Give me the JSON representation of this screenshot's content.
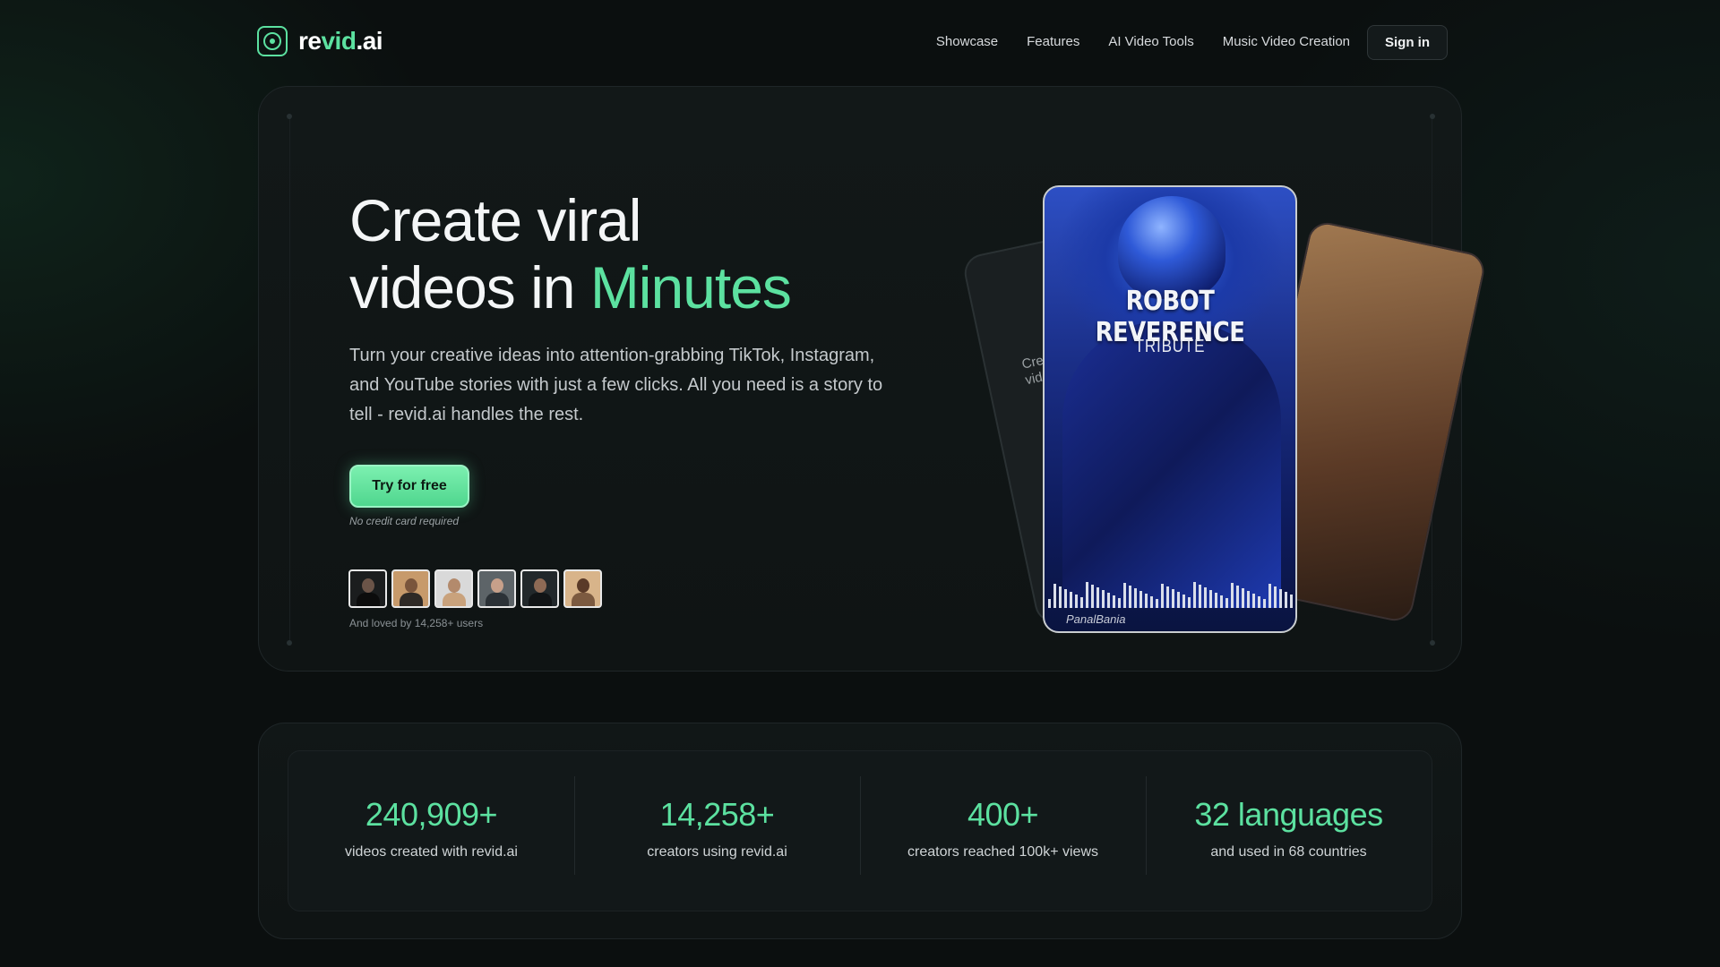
{
  "nav": {
    "logo_text_main": "re",
    "logo_text_accent": "vid",
    "logo_text_suffix": ".ai",
    "links": [
      "Showcase",
      "Features",
      "AI Video Tools",
      "Music Video Creation"
    ],
    "signin_label": "Sign in"
  },
  "hero": {
    "title_line1": "Create viral",
    "title_line2_prefix": "videos in ",
    "title_line2_highlight": "Minutes",
    "description": "Turn your creative ideas into attention-grabbing TikTok, Instagram, and YouTube stories with just a few clicks. All you need is a story to tell - revid.ai handles the rest.",
    "cta_label": "Try for free",
    "no_cc": "No credit card required",
    "loved_by": "And loved by 14,258+ users"
  },
  "phone": {
    "title": "ROBOT REVERENCE",
    "subtitle": "TRIBUTE",
    "brand": "PanalBania",
    "back_left_text": "Cre\nvid"
  },
  "stats": [
    {
      "value": "240,909+",
      "label": "videos created with revid.ai"
    },
    {
      "value": "14,258+",
      "label": "creators using revid.ai"
    },
    {
      "value": "400+",
      "label": "creators reached 100k+ views"
    },
    {
      "value": "32 languages",
      "label": "and used in 68 countries"
    }
  ],
  "colors": {
    "accent": "#5ce1a0",
    "background": "#0b0f0f",
    "card": "#121818"
  }
}
